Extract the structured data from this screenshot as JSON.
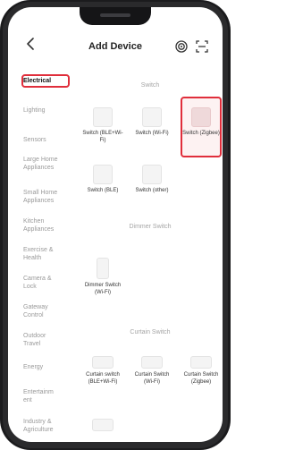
{
  "header": {
    "title": "Add Device",
    "back_icon": "chevron-left-icon",
    "icons": [
      "wifi-scan-icon",
      "qr-scan-icon"
    ]
  },
  "sidebar": {
    "items": [
      {
        "label": "Electrical",
        "active": true
      },
      {
        "label": "Lighting"
      },
      {
        "label": "Sensors"
      },
      {
        "label": "Large Home Appliances"
      },
      {
        "label": "Small Home Appliances"
      },
      {
        "label": "Kitchen Appliances"
      },
      {
        "label": "Exercise & Health"
      },
      {
        "label": "Camera & Lock"
      },
      {
        "label": "Gateway Control"
      },
      {
        "label": "Outdoor Travel"
      },
      {
        "label": "Energy"
      },
      {
        "label": "Entertainment"
      },
      {
        "label": "Industry & Agriculture"
      }
    ]
  },
  "sections": [
    {
      "title": "Switch",
      "devices": [
        {
          "label": "Switch (BLE+Wi-Fi)"
        },
        {
          "label": "Switch (Wi-Fi)"
        },
        {
          "label": "Switch (Zigbee)",
          "highlighted": true
        },
        {
          "label": "Switch (BLE)"
        },
        {
          "label": "Switch (other)"
        }
      ]
    },
    {
      "title": "Dimmer Switch",
      "devices": [
        {
          "label": "Dimmer Switch (Wi-Fi)"
        }
      ]
    },
    {
      "title": "Curtain Switch",
      "devices": [
        {
          "label": "Curtain switch (BLE+Wi-Fi)"
        },
        {
          "label": "Curtain Switch (Wi-Fi)"
        },
        {
          "label": "Curtain Switch (Zigbee)"
        }
      ]
    }
  ],
  "colors": {
    "highlight": "#e02e3b",
    "text": "#222222",
    "muted": "#9a9a9a"
  }
}
